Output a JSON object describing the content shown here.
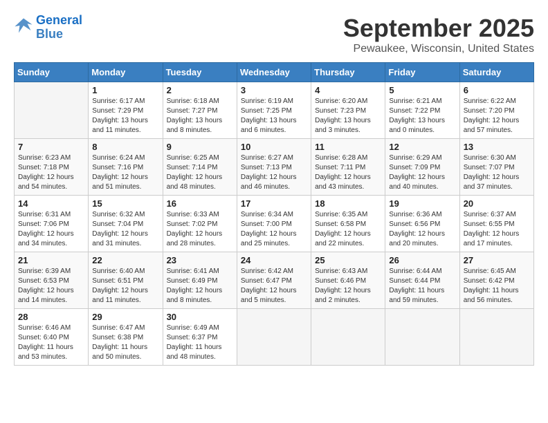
{
  "header": {
    "logo_line1": "General",
    "logo_line2": "Blue",
    "month_title": "September 2025",
    "location": "Pewaukee, Wisconsin, United States"
  },
  "calendar": {
    "days_of_week": [
      "Sunday",
      "Monday",
      "Tuesday",
      "Wednesday",
      "Thursday",
      "Friday",
      "Saturday"
    ],
    "weeks": [
      [
        {
          "day": "",
          "info": ""
        },
        {
          "day": "1",
          "info": "Sunrise: 6:17 AM\nSunset: 7:29 PM\nDaylight: 13 hours\nand 11 minutes."
        },
        {
          "day": "2",
          "info": "Sunrise: 6:18 AM\nSunset: 7:27 PM\nDaylight: 13 hours\nand 8 minutes."
        },
        {
          "day": "3",
          "info": "Sunrise: 6:19 AM\nSunset: 7:25 PM\nDaylight: 13 hours\nand 6 minutes."
        },
        {
          "day": "4",
          "info": "Sunrise: 6:20 AM\nSunset: 7:23 PM\nDaylight: 13 hours\nand 3 minutes."
        },
        {
          "day": "5",
          "info": "Sunrise: 6:21 AM\nSunset: 7:22 PM\nDaylight: 13 hours\nand 0 minutes."
        },
        {
          "day": "6",
          "info": "Sunrise: 6:22 AM\nSunset: 7:20 PM\nDaylight: 12 hours\nand 57 minutes."
        }
      ],
      [
        {
          "day": "7",
          "info": "Sunrise: 6:23 AM\nSunset: 7:18 PM\nDaylight: 12 hours\nand 54 minutes."
        },
        {
          "day": "8",
          "info": "Sunrise: 6:24 AM\nSunset: 7:16 PM\nDaylight: 12 hours\nand 51 minutes."
        },
        {
          "day": "9",
          "info": "Sunrise: 6:25 AM\nSunset: 7:14 PM\nDaylight: 12 hours\nand 48 minutes."
        },
        {
          "day": "10",
          "info": "Sunrise: 6:27 AM\nSunset: 7:13 PM\nDaylight: 12 hours\nand 46 minutes."
        },
        {
          "day": "11",
          "info": "Sunrise: 6:28 AM\nSunset: 7:11 PM\nDaylight: 12 hours\nand 43 minutes."
        },
        {
          "day": "12",
          "info": "Sunrise: 6:29 AM\nSunset: 7:09 PM\nDaylight: 12 hours\nand 40 minutes."
        },
        {
          "day": "13",
          "info": "Sunrise: 6:30 AM\nSunset: 7:07 PM\nDaylight: 12 hours\nand 37 minutes."
        }
      ],
      [
        {
          "day": "14",
          "info": "Sunrise: 6:31 AM\nSunset: 7:06 PM\nDaylight: 12 hours\nand 34 minutes."
        },
        {
          "day": "15",
          "info": "Sunrise: 6:32 AM\nSunset: 7:04 PM\nDaylight: 12 hours\nand 31 minutes."
        },
        {
          "day": "16",
          "info": "Sunrise: 6:33 AM\nSunset: 7:02 PM\nDaylight: 12 hours\nand 28 minutes."
        },
        {
          "day": "17",
          "info": "Sunrise: 6:34 AM\nSunset: 7:00 PM\nDaylight: 12 hours\nand 25 minutes."
        },
        {
          "day": "18",
          "info": "Sunrise: 6:35 AM\nSunset: 6:58 PM\nDaylight: 12 hours\nand 22 minutes."
        },
        {
          "day": "19",
          "info": "Sunrise: 6:36 AM\nSunset: 6:56 PM\nDaylight: 12 hours\nand 20 minutes."
        },
        {
          "day": "20",
          "info": "Sunrise: 6:37 AM\nSunset: 6:55 PM\nDaylight: 12 hours\nand 17 minutes."
        }
      ],
      [
        {
          "day": "21",
          "info": "Sunrise: 6:39 AM\nSunset: 6:53 PM\nDaylight: 12 hours\nand 14 minutes."
        },
        {
          "day": "22",
          "info": "Sunrise: 6:40 AM\nSunset: 6:51 PM\nDaylight: 12 hours\nand 11 minutes."
        },
        {
          "day": "23",
          "info": "Sunrise: 6:41 AM\nSunset: 6:49 PM\nDaylight: 12 hours\nand 8 minutes."
        },
        {
          "day": "24",
          "info": "Sunrise: 6:42 AM\nSunset: 6:47 PM\nDaylight: 12 hours\nand 5 minutes."
        },
        {
          "day": "25",
          "info": "Sunrise: 6:43 AM\nSunset: 6:46 PM\nDaylight: 12 hours\nand 2 minutes."
        },
        {
          "day": "26",
          "info": "Sunrise: 6:44 AM\nSunset: 6:44 PM\nDaylight: 11 hours\nand 59 minutes."
        },
        {
          "day": "27",
          "info": "Sunrise: 6:45 AM\nSunset: 6:42 PM\nDaylight: 11 hours\nand 56 minutes."
        }
      ],
      [
        {
          "day": "28",
          "info": "Sunrise: 6:46 AM\nSunset: 6:40 PM\nDaylight: 11 hours\nand 53 minutes."
        },
        {
          "day": "29",
          "info": "Sunrise: 6:47 AM\nSunset: 6:38 PM\nDaylight: 11 hours\nand 50 minutes."
        },
        {
          "day": "30",
          "info": "Sunrise: 6:49 AM\nSunset: 6:37 PM\nDaylight: 11 hours\nand 48 minutes."
        },
        {
          "day": "",
          "info": ""
        },
        {
          "day": "",
          "info": ""
        },
        {
          "day": "",
          "info": ""
        },
        {
          "day": "",
          "info": ""
        }
      ]
    ]
  }
}
